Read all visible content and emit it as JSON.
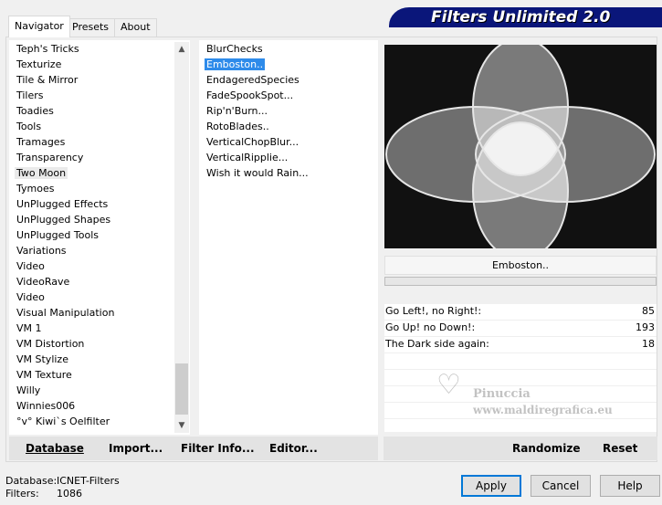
{
  "tabs": [
    "Navigator",
    "Presets",
    "About"
  ],
  "banner_title": "Filters Unlimited 2.0",
  "categories": [
    "Teph's Tricks",
    "Texturize",
    "Tile & Mirror",
    "Tilers",
    "Toadies",
    "Tools",
    "Tramages",
    "Transparency",
    "Two Moon",
    "Tymoes",
    "UnPlugged Effects",
    "UnPlugged Shapes",
    "UnPlugged Tools",
    "Variations",
    "Video",
    "VideoRave",
    "Video",
    "Visual Manipulation",
    "VM 1",
    "VM Distortion",
    "VM Stylize",
    "VM Texture",
    "Willy",
    "Winnies006",
    "°v° Kiwi`s Oelfilter"
  ],
  "highlighted_category": "Two Moon",
  "filters": [
    "BlurChecks",
    "Emboston..",
    "EndageredSpecies",
    "FadeSpookSpot...",
    "Rip'n'Burn...",
    "RotoBlades..",
    "VerticalChopBlur...",
    "VerticalRipplie...",
    "Wish it would Rain..."
  ],
  "selected_filter": "Emboston..",
  "scroll_up_glyph": "▲",
  "scroll_down_glyph": "▼",
  "left_buttons": {
    "database": "Database",
    "import": "Import...",
    "filter_info": "Filter Info...",
    "editor": "Editor..."
  },
  "filter_name": "Emboston..",
  "progress": 0,
  "sliders": [
    {
      "label": "Go Left!, no Right!:",
      "value": "85"
    },
    {
      "label": "Go Up! no Down!:",
      "value": "193"
    },
    {
      "label": "The Dark side again:",
      "value": "18"
    }
  ],
  "right_buttons": {
    "randomize": "Randomize",
    "reset": "Reset"
  },
  "watermark": {
    "line1": "Pinuccia",
    "line2": "www.maldiregrafica.eu"
  },
  "status": {
    "database_label": "Database:",
    "database_value": "ICNET-Filters",
    "filters_label": "Filters:",
    "filters_value": "1086"
  },
  "dialog_buttons": {
    "apply": "Apply",
    "cancel": "Cancel",
    "help": "Help"
  },
  "colors": {
    "banner": "#0a167a",
    "selection": "#2e8bea",
    "default_border": "#0078d7"
  }
}
